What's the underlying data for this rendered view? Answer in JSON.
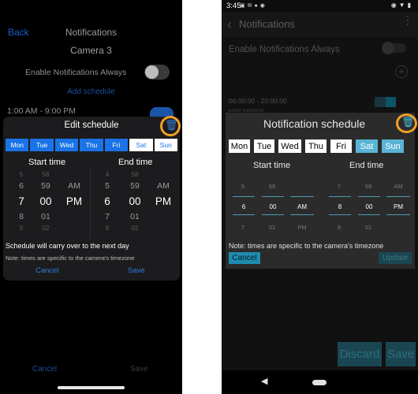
{
  "ios": {
    "header": {
      "back_label": "Back",
      "title": "Notifications"
    },
    "camera_name": "Camera 3",
    "enable_always_label": "Enable Notifications Always",
    "add_schedule_label": "Add schedule",
    "schedule_time": "1:00 AM - 9:00 PM",
    "footer": {
      "cancel_label": "Cancel",
      "save_label": "Save"
    },
    "modal": {
      "title": "Edit schedule",
      "trash_icon": "trash-icon",
      "days": [
        {
          "label": "Mon",
          "selected": true
        },
        {
          "label": "Tue",
          "selected": true
        },
        {
          "label": "Wed",
          "selected": true
        },
        {
          "label": "Thu",
          "selected": true
        },
        {
          "label": "Fri",
          "selected": true
        },
        {
          "label": "Sat",
          "selected": false
        },
        {
          "label": "Sun",
          "selected": false
        }
      ],
      "start_label": "Start time",
      "end_label": "End time",
      "start_wheel": {
        "hour": [
          "5",
          "6",
          "7",
          "8",
          "9"
        ],
        "minute": [
          "58",
          "59",
          "00",
          "01",
          "02"
        ],
        "ampm": [
          "AM",
          "PM"
        ]
      },
      "end_wheel": {
        "hour": [
          "4",
          "5",
          "6",
          "7",
          "8"
        ],
        "minute": [
          "58",
          "59",
          "00",
          "01",
          "02"
        ],
        "ampm": [
          "AM",
          "PM"
        ]
      },
      "note_carry_over": "Schedule will carry over to the next day",
      "note_timezone": "Note: times are specific to the camera's timezone",
      "cancel_label": "Cancel",
      "save_label": "Save"
    },
    "colors": {
      "accent": "#1a73e8",
      "highlight_ring": "#f0a023"
    }
  },
  "android": {
    "status_bar": {
      "clock": "3:45"
    },
    "header": {
      "title": "Notifications"
    },
    "enable_always_label": "Enable Notifications Always",
    "schedule_time": "06:00:00 - 20:00:00",
    "schedule_days": "every weekend",
    "bottom": {
      "discard_label": "Discard",
      "save_label": "Save"
    },
    "modal": {
      "title": "Notification schedule",
      "trash_icon": "trash-icon",
      "days": [
        {
          "label": "Mon",
          "selected": false
        },
        {
          "label": "Tue",
          "selected": false
        },
        {
          "label": "Wed",
          "selected": false
        },
        {
          "label": "Thu",
          "selected": false
        },
        {
          "label": "Fri",
          "selected": false
        },
        {
          "label": "Sat",
          "selected": true
        },
        {
          "label": "Sun",
          "selected": true
        }
      ],
      "start_label": "Start time",
      "end_label": "End time",
      "start_picker": {
        "hour": {
          "prev": "5",
          "current": "6",
          "next": "7"
        },
        "minute": {
          "prev": "59",
          "current": "00",
          "next": "01"
        },
        "ampm": {
          "current": "AM",
          "next": "PM"
        }
      },
      "end_picker": {
        "hour": {
          "prev": "7",
          "current": "8",
          "next": "9"
        },
        "minute": {
          "prev": "59",
          "current": "00",
          "next": "01"
        },
        "ampm": {
          "prev": "AM",
          "current": "PM"
        }
      },
      "note_timezone": "Note: times are specific to the camera's timezone",
      "cancel_label": "Cancel",
      "update_label": "Update"
    },
    "colors": {
      "accent": "#5ab4d6",
      "button": "#1e8cb0",
      "highlight_ring": "#f0a023"
    }
  }
}
